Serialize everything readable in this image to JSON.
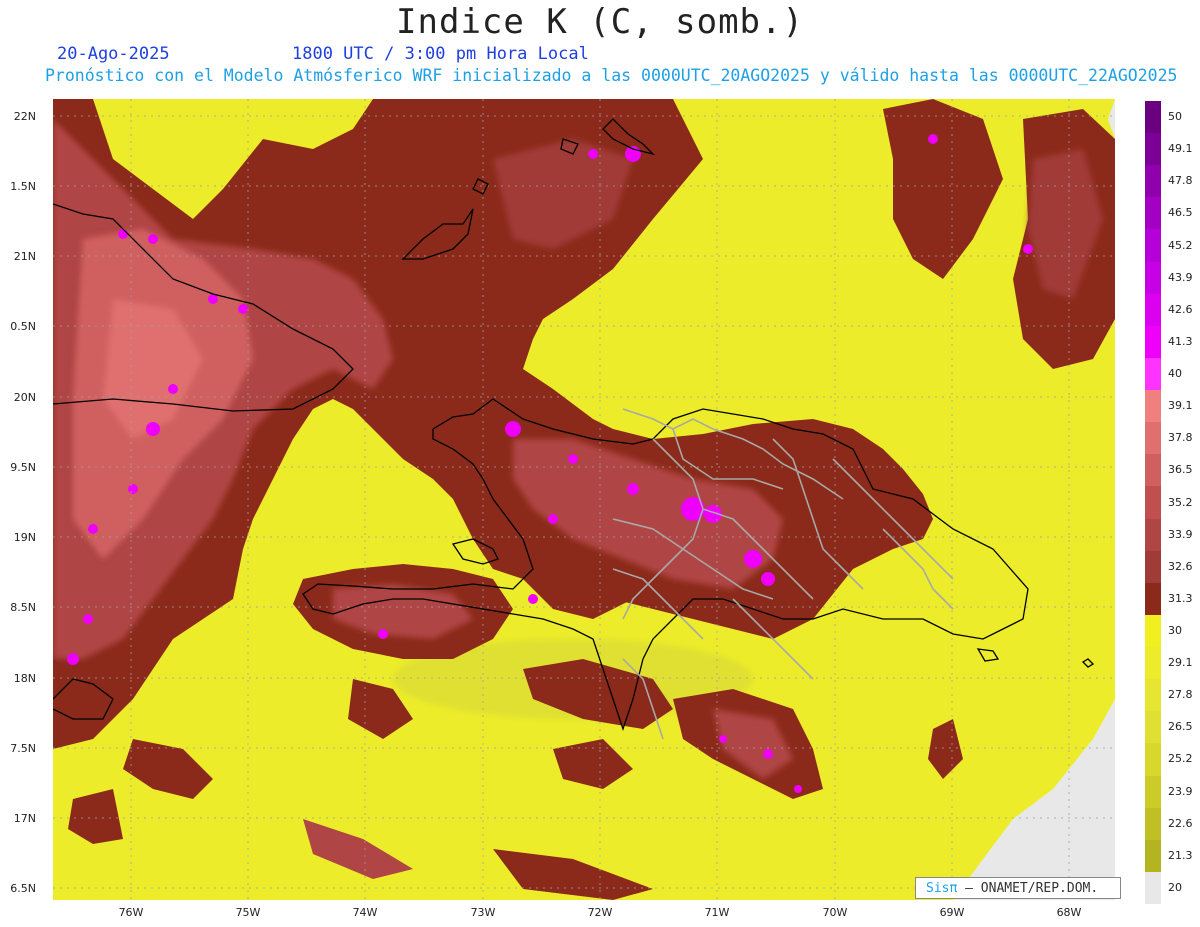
{
  "header": {
    "title": "Indice K (C, somb.)",
    "date": "20-Ago-2025",
    "time": "1800 UTC / 3:00 pm Hora Local",
    "subtitle": "Pronóstico con el Modelo Atmósferico WRF inicializado a las 0000UTC_20AGO2025 y válido hasta las  0000UTC_22AGO2025"
  },
  "map": {
    "lat_labels": [
      "22N",
      "1.5N",
      "21N",
      "0.5N",
      "20N",
      "9.5N",
      "19N",
      "8.5N",
      "18N",
      "7.5N",
      "17N",
      "6.5N"
    ],
    "lon_labels": [
      "76W",
      "75W",
      "74W",
      "73W",
      "72W",
      "71W",
      "70W",
      "69W",
      "68W"
    ]
  },
  "colorbar": {
    "labels": [
      "50",
      "49.1",
      "47.8",
      "46.5",
      "45.2",
      "43.9",
      "42.6",
      "41.3",
      "40",
      "39.1",
      "37.8",
      "36.5",
      "35.2",
      "33.9",
      "32.6",
      "31.3",
      "30",
      "29.1",
      "27.8",
      "26.5",
      "25.2",
      "23.9",
      "22.6",
      "21.3",
      "20"
    ],
    "colors": [
      "#6a0080",
      "#7d0096",
      "#9000ad",
      "#a300c4",
      "#b600d9",
      "#c800e6",
      "#db00f0",
      "#ee00fa",
      "#ff33ff",
      "#f08080",
      "#e07070",
      "#d06060",
      "#c05050",
      "#b04545",
      "#a03b38",
      "#8b2a1a",
      "#f0f020",
      "#ecec2a",
      "#e6e632",
      "#e0e032",
      "#d8d82c",
      "#cccc28",
      "#c0c024",
      "#b4b420",
      "#e8e8e8"
    ]
  },
  "credit": {
    "logo": "Sisπ",
    "text": "– ONAMET/REP.DOM."
  }
}
